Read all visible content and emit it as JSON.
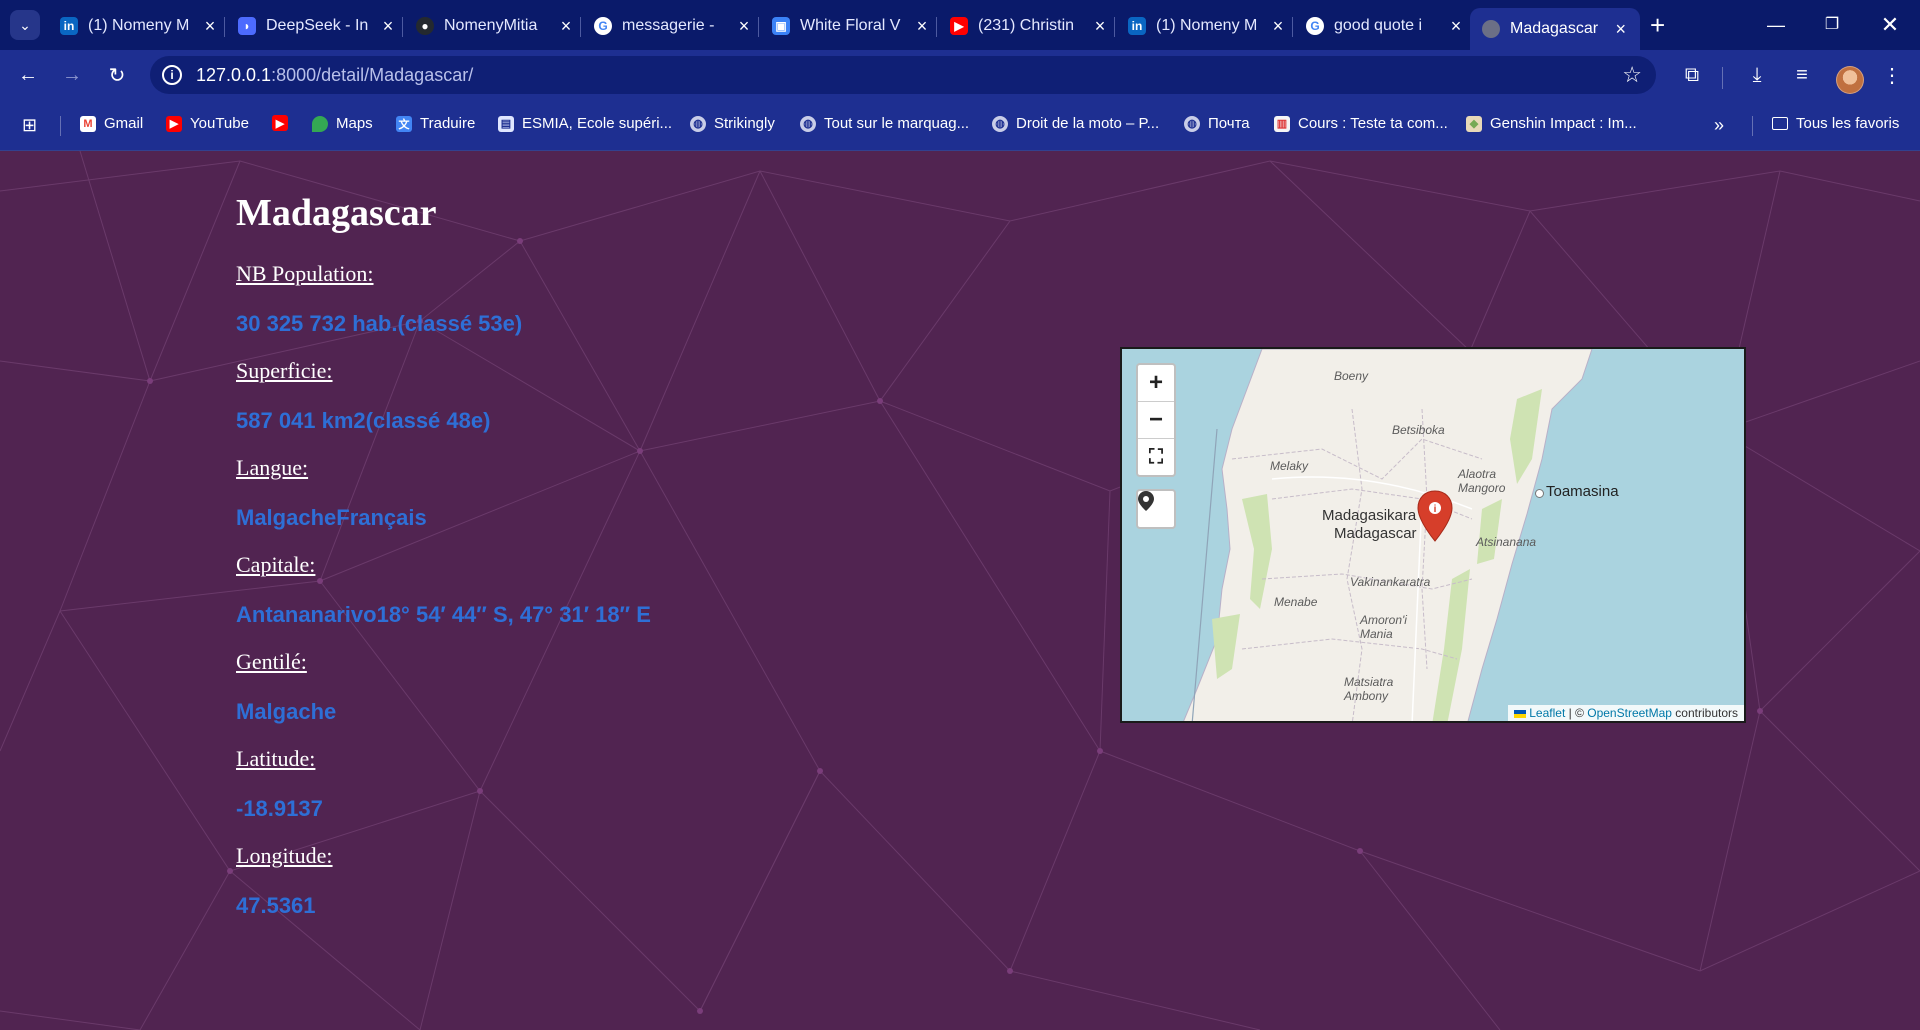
{
  "browser": {
    "tabs": [
      {
        "title": "(1) Nomeny M",
        "icon": "linkedin-icon",
        "color": "#0a66c2"
      },
      {
        "title": "DeepSeek - In",
        "icon": "deepseek-icon",
        "color": "#4d6bfe"
      },
      {
        "title": "NomenyMitia",
        "icon": "github-icon",
        "color": "#24292f"
      },
      {
        "title": "messagerie -",
        "icon": "google-icon",
        "color": "#ffffff"
      },
      {
        "title": "White Floral V",
        "icon": "app-icon",
        "color": "#3b82f6"
      },
      {
        "title": "(231) Christin",
        "icon": "youtube-icon",
        "color": "#ff0000"
      },
      {
        "title": "(1) Nomeny M",
        "icon": "linkedin-icon",
        "color": "#0a66c2"
      },
      {
        "title": "good quote i",
        "icon": "google-icon",
        "color": "#ffffff"
      }
    ],
    "active_tab": {
      "title": "Madagascar",
      "icon": "globe-icon"
    },
    "url_host": "127.0.0.1",
    "url_rest": ":8000/detail/Madagascar/",
    "bookmarks": [
      {
        "label": "Gmail",
        "icon": "gmail-icon"
      },
      {
        "label": "YouTube",
        "icon": "youtube-icon"
      },
      {
        "label": "",
        "icon": "youtube-icon"
      },
      {
        "label": "Maps",
        "icon": "maps-icon"
      },
      {
        "label": "Traduire",
        "icon": "translate-icon"
      },
      {
        "label": "ESMIA, Ecole supéri...",
        "icon": "esmia-icon"
      },
      {
        "label": "Strikingly",
        "icon": "globe-icon"
      },
      {
        "label": "Tout sur le marquag...",
        "icon": "globe-icon"
      },
      {
        "label": "Droit de la moto – P...",
        "icon": "globe-icon"
      },
      {
        "label": "Почта",
        "icon": "globe-icon"
      },
      {
        "label": "Cours : Teste ta com...",
        "icon": "cours-icon"
      },
      {
        "label": "Genshin Impact : Im...",
        "icon": "genshin-icon"
      }
    ],
    "all_bookmarks": "Tous les favoris"
  },
  "country": {
    "name": "Madagascar",
    "fields": [
      {
        "label": "NB Population:",
        "value": "30 325 732 hab.(classé 53e)"
      },
      {
        "label": "Superficie:",
        "value": "587 041 km2(classé 48e)"
      },
      {
        "label": "Langue:",
        "value": "MalgacheFrançais"
      },
      {
        "label": "Capitale:",
        "value": "Antananarivo18° 54′ 44″ S, 47° 31′ 18″ E"
      },
      {
        "label": "Gentilé:",
        "value": "Malgache"
      },
      {
        "label": "Latitude:",
        "value": "-18.9137"
      },
      {
        "label": "Longitude:",
        "value": "47.5361"
      }
    ]
  },
  "map": {
    "zoom_in": "+",
    "zoom_out": "−",
    "regions": [
      "Boeny",
      "Betsiboka",
      "Melaky",
      "Alaotra Mangoro",
      "Atsinanana",
      "Vakinankaratra",
      "Menabe",
      "Amoron'i Mania",
      "Matsiatra Ambony"
    ],
    "capital_label_1": "Madagasikara",
    "capital_label_2": "Madagascar",
    "city": "Toamasina",
    "attribution_leaflet": "Leaflet",
    "attribution_sep": " | © ",
    "attribution_osm": "OpenStreetMap",
    "attribution_tail": " contributors",
    "colors": {
      "sea": "#aad3df",
      "land": "#f2efe9",
      "marker": "#d63e2a"
    }
  },
  "colors": {
    "page_bg": "#512451",
    "value_text": "#2e6fd6",
    "browser_frame": "#1e2f91"
  }
}
